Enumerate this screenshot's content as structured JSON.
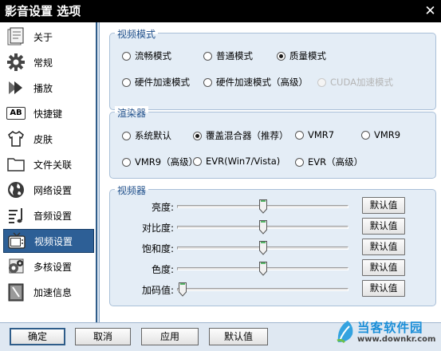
{
  "window": {
    "title": "影音设置 选项",
    "close_glyph": "✕"
  },
  "sidebar": {
    "items": [
      {
        "label": "关于",
        "icon": "about-icon"
      },
      {
        "label": "常规",
        "icon": "gear-icon"
      },
      {
        "label": "播放",
        "icon": "play-icon"
      },
      {
        "label": "快捷键",
        "icon": "keyboard-icon",
        "icon_text": "AB"
      },
      {
        "label": "皮肤",
        "icon": "tshirt-icon"
      },
      {
        "label": "文件关联",
        "icon": "folder-icon"
      },
      {
        "label": "网络设置",
        "icon": "globe-icon"
      },
      {
        "label": "音频设置",
        "icon": "audio-icon"
      },
      {
        "label": "视频设置",
        "icon": "tv-icon",
        "selected": true
      },
      {
        "label": "多核设置",
        "icon": "multicore-icon"
      },
      {
        "label": "加速信息",
        "icon": "speed-info-icon"
      }
    ]
  },
  "video_mode": {
    "title": "视频模式",
    "options": [
      {
        "label": "流畅模式",
        "checked": false
      },
      {
        "label": "普通模式",
        "checked": false
      },
      {
        "label": "质量模式",
        "checked": true
      },
      {
        "label": "硬件加速模式",
        "checked": false
      },
      {
        "label": "硬件加速模式（高级）",
        "checked": false
      },
      {
        "label": "CUDA加速模式",
        "checked": false,
        "disabled": true
      }
    ]
  },
  "renderer": {
    "title": "渲染器",
    "options": [
      {
        "label": "系统默认",
        "checked": false
      },
      {
        "label": "覆盖混合器（推荐）",
        "checked": true
      },
      {
        "label": "VMR7",
        "checked": false
      },
      {
        "label": "VMR9",
        "checked": false
      },
      {
        "label": "VMR9（高级）",
        "checked": false
      },
      {
        "label": "EVR(Win7/Vista)",
        "checked": false
      },
      {
        "label": "EVR（高级）",
        "checked": false
      }
    ]
  },
  "video_adjust": {
    "title": "视频器",
    "sliders": [
      {
        "label": "亮度:",
        "value": 0.5,
        "button": "默认值"
      },
      {
        "label": "对比度:",
        "value": 0.5,
        "button": "默认值"
      },
      {
        "label": "饱和度:",
        "value": 0.5,
        "button": "默认值"
      },
      {
        "label": "色度:",
        "value": 0.5,
        "button": "默认值"
      },
      {
        "label": "加码值:",
        "value": 0.0,
        "button": "默认值"
      }
    ]
  },
  "footer": {
    "ok": "确定",
    "cancel": "取消",
    "apply": "应用",
    "defaults": "默认值"
  },
  "watermark": {
    "name": "当客软件园",
    "url": "www.downkr.com"
  },
  "colors": {
    "accent": "#2d5f96",
    "group_bg": "#e4edf6",
    "group_title": "#1f4f8a"
  }
}
